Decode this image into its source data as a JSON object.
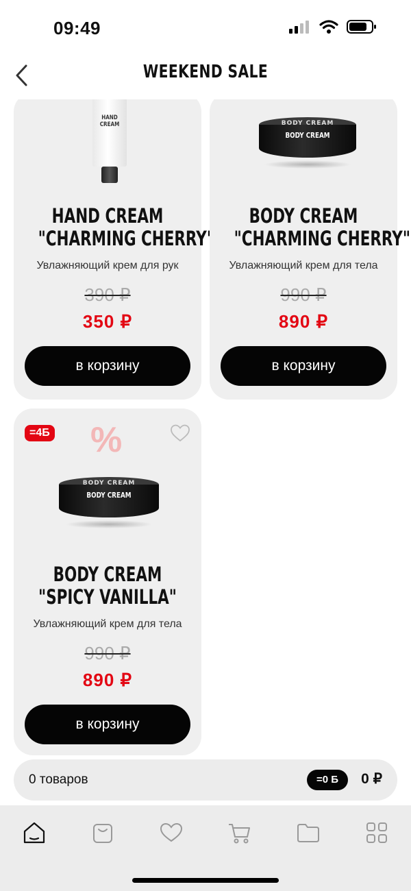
{
  "status_bar": {
    "time": "09:49"
  },
  "header": {
    "title": "WEEKEND SALE"
  },
  "products": [
    {
      "name_line1": "HAND CREAM",
      "name_line2": "\"CHARMING CHERRY\"",
      "description": "Увлажняющий крем для рук",
      "old_price": "390 ₽",
      "new_price": "350 ₽",
      "button": "в корзину",
      "image_label": "HAND CREAM"
    },
    {
      "name_line1": "BODY CREAM",
      "name_line2": "\"CHARMING CHERRY\"",
      "description": "Увлажняющий крем для тела",
      "old_price": "990 ₽",
      "new_price": "890 ₽",
      "button": "в корзину",
      "image_label": "BODY CREAM",
      "lid_label": "BODY CREAM"
    },
    {
      "badge": "=4Б",
      "promo_symbol": "%",
      "name_line1": "BODY CREAM",
      "name_line2": "\"SPICY VANILLA\"",
      "description": "Увлажняющий крем для тела",
      "old_price": "990 ₽",
      "new_price": "890 ₽",
      "button": "в корзину",
      "image_label": "BODY CREAM",
      "lid_label": "BODY CREAM"
    }
  ],
  "summary": {
    "count": "0 товаров",
    "points": "=0 Б",
    "total": "0 ₽"
  },
  "tabbar": {
    "items": [
      "home-icon",
      "bag-icon",
      "heart-icon",
      "cart-icon",
      "folder-icon",
      "grid-icon"
    ]
  }
}
